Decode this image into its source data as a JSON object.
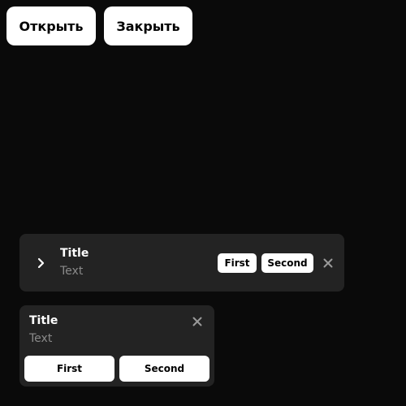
{
  "controls": {
    "open_label": "Открыть",
    "close_label": "Закрыть"
  },
  "snackbar_row": {
    "title": "Title",
    "text": "Text",
    "first_label": "First",
    "second_label": "Second",
    "expand_icon": "chevron-right-icon",
    "close_icon": "close-icon"
  },
  "snackbar_card": {
    "title": "Title",
    "text": "Text",
    "first_label": "First",
    "second_label": "Second",
    "close_icon": "close-icon"
  },
  "colors": {
    "background": "#0a0a0a",
    "surface": "#232323",
    "button": "#ffffff",
    "primary_text": "#ffffff",
    "secondary_text": "#8a8a8a",
    "icon_muted": "#9a9a9a"
  }
}
